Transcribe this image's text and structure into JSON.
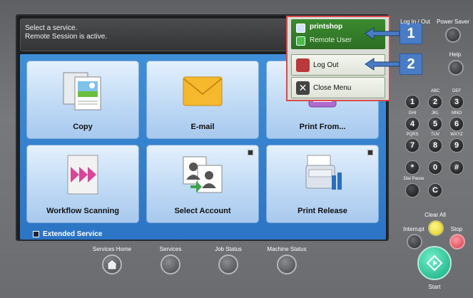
{
  "message": {
    "line1": "Select a service.",
    "line2": "Remote Session is active."
  },
  "tiles": [
    {
      "label": "Copy"
    },
    {
      "label": "E-mail"
    },
    {
      "label": "Print From..."
    },
    {
      "label": "Workflow Scanning"
    },
    {
      "label": "Select Account"
    },
    {
      "label": "Print Release"
    }
  ],
  "extended_service": "Extended Service",
  "popup": {
    "user_name": "printshop",
    "session": "Remote User",
    "logout": "Log Out",
    "close_menu": "Close Menu"
  },
  "callouts": [
    "1",
    "2"
  ],
  "panel": {
    "login_logout": "Log In / Out",
    "power_saver": "Power Saver",
    "help": "Help",
    "dial_pause": "Dial Pause",
    "clear_all": "Clear All",
    "interrupt": "Interrupt",
    "stop": "Stop",
    "start": "Start"
  },
  "keypad": [
    {
      "key": "1",
      "sub": ""
    },
    {
      "key": "2",
      "sub": "ABC"
    },
    {
      "key": "3",
      "sub": "DEF"
    },
    {
      "key": "4",
      "sub": "GHI"
    },
    {
      "key": "5",
      "sub": "JKL"
    },
    {
      "key": "6",
      "sub": "MNO"
    },
    {
      "key": "7",
      "sub": "PQRS"
    },
    {
      "key": "8",
      "sub": "TUV"
    },
    {
      "key": "9",
      "sub": "WXYZ"
    },
    {
      "key": "*",
      "sub": ""
    },
    {
      "key": "0",
      "sub": ""
    },
    {
      "key": "#",
      "sub": ""
    },
    {
      "key": "C",
      "sub": ""
    }
  ],
  "bottom": {
    "services_home": "Services Home",
    "services": "Services",
    "job_status": "Job Status",
    "machine_status": "Machine Status"
  },
  "colors": {
    "tile_area": "#2c74c4",
    "user_row": "#2d6e25",
    "callout": "#4a7cc6",
    "popup_border": "#d84a4a",
    "start_button": "#19b88d",
    "stop_button": "#e0505a",
    "clear_all_button": "#f2e33a"
  }
}
